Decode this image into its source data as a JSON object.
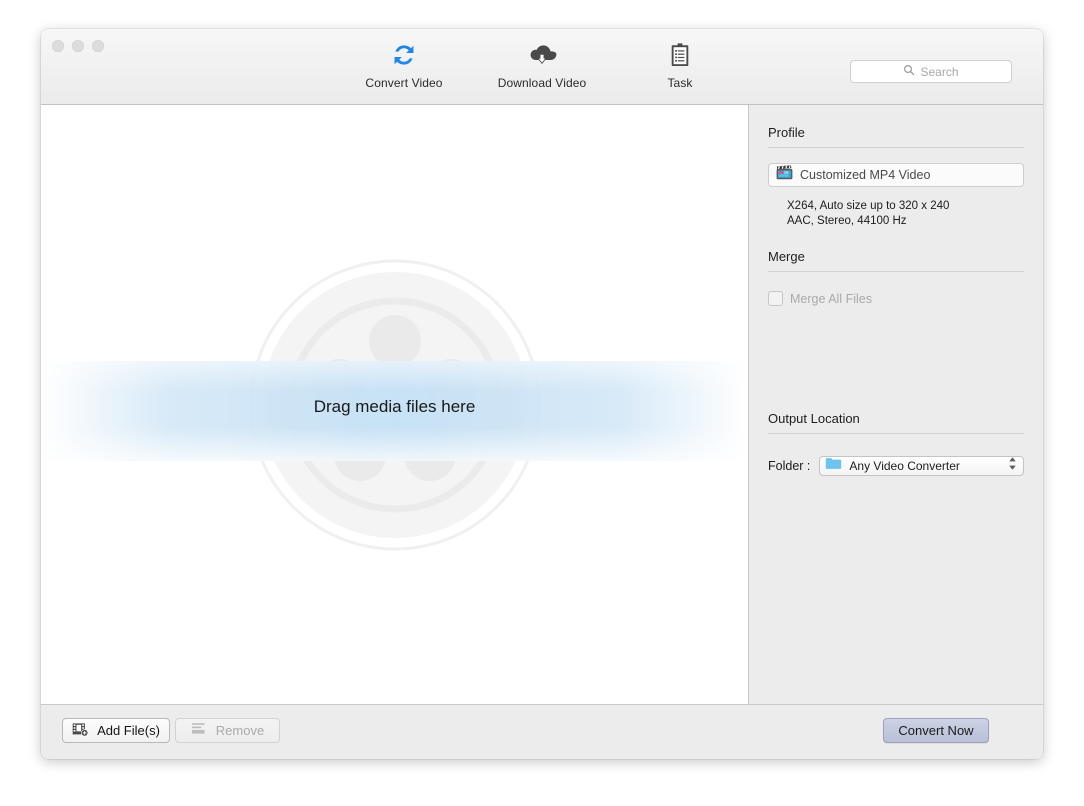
{
  "window": {
    "traffic_lights": [
      "close",
      "minimize",
      "zoom"
    ]
  },
  "toolbar": {
    "items": [
      {
        "label": "Convert Video",
        "icon": "convert-refresh-icon",
        "active": true
      },
      {
        "label": "Download Video",
        "icon": "cloud-download-icon",
        "active": false
      },
      {
        "label": "Task",
        "icon": "clipboard-task-icon",
        "active": false
      }
    ],
    "search": {
      "placeholder": "Search",
      "value": "",
      "icon": "search-icon"
    }
  },
  "drop_area": {
    "message": "Drag media files here",
    "watermark": "film-reel-watermark"
  },
  "sidebar": {
    "profile": {
      "title": "Profile",
      "selected": "Customized MP4 Video",
      "icon": "clapperboard-icon",
      "description_line1": "X264, Auto size up to 320 x 240",
      "description_line2": "AAC, Stereo, 44100 Hz"
    },
    "merge": {
      "title": "Merge",
      "checkbox_label": "Merge All Files",
      "checked": false,
      "disabled": true
    },
    "output": {
      "title": "Output Location",
      "folder_label": "Folder :",
      "folder_value": "Any Video Converter",
      "folder_icon": "folder-icon"
    }
  },
  "bottom_bar": {
    "add_files_label": "Add File(s)",
    "add_files_icon": "film-add-icon",
    "remove_label": "Remove",
    "remove_icon": "list-remove-icon",
    "remove_disabled": true,
    "convert_label": "Convert Now"
  },
  "colors": {
    "accent_blue": "#1f87e8",
    "toolbar_icon_gray": "#4a4a4a",
    "window_chrome": "#ececec",
    "convert_button": "#c3c9de",
    "band_blue": "#c4e0f5"
  }
}
